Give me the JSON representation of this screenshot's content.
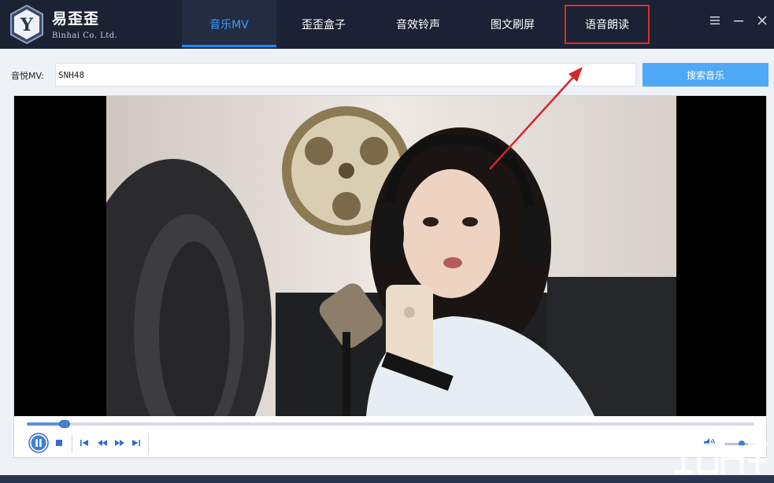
{
  "app": {
    "name": "易歪歪",
    "company": "Binhai Co. Ltd."
  },
  "tabs": [
    {
      "label": "音乐MV",
      "active": true
    },
    {
      "label": "歪歪盒子",
      "active": false
    },
    {
      "label": "音效铃声",
      "active": false
    },
    {
      "label": "图文刷屏",
      "active": false
    },
    {
      "label": "语音朗读",
      "active": false,
      "highlighted": true
    }
  ],
  "window_controls": {
    "menu": "≡",
    "minimize": "−",
    "close": "✕"
  },
  "search": {
    "label": "音悦MV:",
    "value": "SNH48",
    "button_label": "搜索音乐"
  },
  "player": {
    "progress": 0.052,
    "volume": 0.55,
    "controls": [
      "pause-icon",
      "stop-icon",
      "skip-back-icon",
      "rewind-icon",
      "fast-forward-icon",
      "skip-forward-icon",
      "volume-icon"
    ]
  },
  "colors": {
    "titlebar": "#1b2233",
    "accent": "#1e88ff",
    "search_button": "#4fa8f5",
    "annotation": "#e02a2a"
  }
}
